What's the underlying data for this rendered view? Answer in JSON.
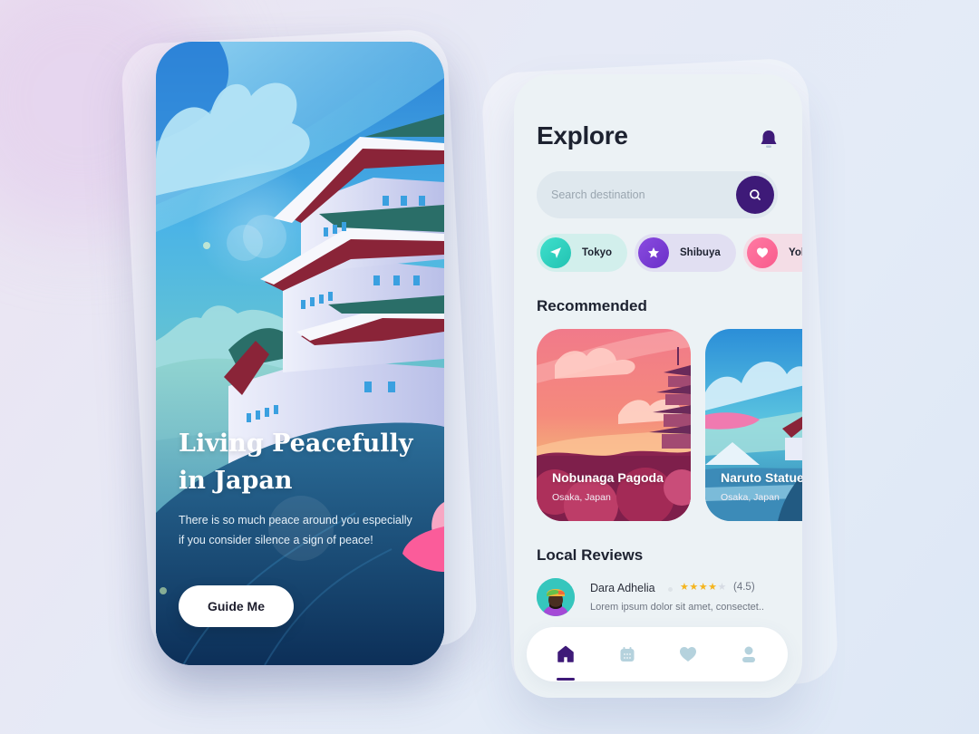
{
  "onboarding": {
    "title_line1": "Living Peacefully",
    "title_line2": "in Japan",
    "description": "There is so much peace around you especially if you consider silence a sign of peace!",
    "button_label": "Guide Me",
    "illustration": "japanese-castle-pagoda-illustration"
  },
  "explore": {
    "title": "Explore",
    "notification_icon": "bell-icon",
    "search": {
      "placeholder": "Search destination",
      "value": "",
      "button_icon": "search-icon"
    },
    "categories": [
      {
        "label": "Tokyo",
        "icon": "paper-plane-icon",
        "color": "#2fd3c2",
        "bg": "#d2efec"
      },
      {
        "label": "Shibuya",
        "icon": "star-icon",
        "color": "#7a3fd6",
        "bg": "#e1dff2"
      },
      {
        "label": "Yokohama",
        "icon": "heart-icon",
        "color": "#fd6d97",
        "bg": "#f4dde6"
      }
    ],
    "recommended_title": "Recommended",
    "recommended": [
      {
        "name": "Nobunaga Pagoda",
        "location": "Osaka, Japan"
      },
      {
        "name": "Naruto Statue",
        "location": "Osaka, Japan"
      }
    ],
    "reviews_title": "Local Reviews",
    "reviews": [
      {
        "name": "Dara Adhelia",
        "rating": 4.5,
        "rating_label": "(4.5)",
        "stars_filled": 4,
        "stars_total": 5,
        "text": "Lorem ipsum dolor sit amet, consectet.."
      }
    ],
    "nav": [
      {
        "name": "home",
        "icon": "home-icon",
        "active": true
      },
      {
        "name": "calendar",
        "icon": "calendar-icon",
        "active": false
      },
      {
        "name": "favorites",
        "icon": "heart-icon",
        "active": false
      },
      {
        "name": "profile",
        "icon": "user-icon",
        "active": false
      }
    ],
    "accent_color": "#3e1a78"
  }
}
